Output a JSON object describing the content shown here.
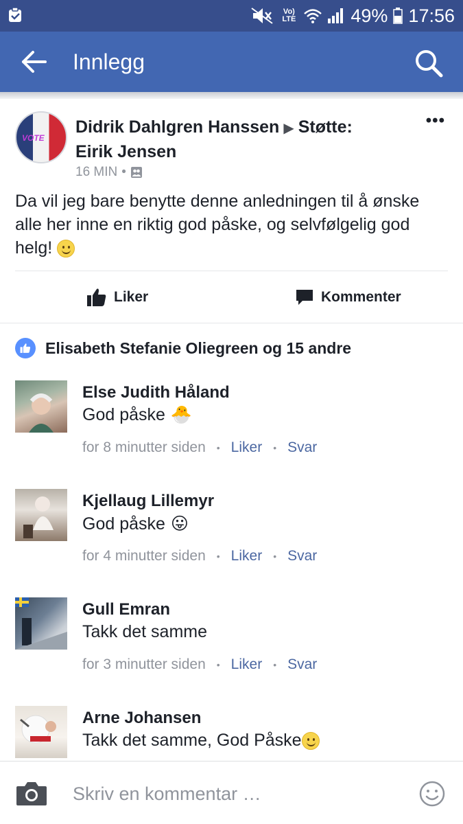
{
  "status_bar": {
    "volte_label": "Vo) LTE",
    "battery": "49%",
    "time": "17:56"
  },
  "app_bar": {
    "title": "Innlegg"
  },
  "post": {
    "author_line": "Didrik Dahlgren Hanssen",
    "target_line": "Støtte: Eirik Jensen",
    "time": "16 MIN",
    "separator": "•",
    "text": "Da vil jeg bare benytte denne anledningen til å ønske alle her inne en riktig god påske, og selvfølgelig god helg!",
    "more_label": "•••",
    "like_label": "Liker",
    "comment_label": "Kommenter"
  },
  "reactions": {
    "summary": "Elisabeth Stefanie Oliegreen og 15 andre"
  },
  "comments": [
    {
      "name": "Else Judith Håland",
      "text": "God påske",
      "emoji": "🐣",
      "time": "for 8 minutter siden",
      "like": "Liker",
      "reply": "Svar"
    },
    {
      "name": "Kjellaug Lillemyr",
      "text": "God påske",
      "emoji": "😛",
      "time": "for 4 minutter siden",
      "like": "Liker",
      "reply": "Svar"
    },
    {
      "name": "Gull Emran",
      "text": "Takk det samme",
      "emoji": "",
      "time": "for 3 minutter siden",
      "like": "Liker",
      "reply": "Svar"
    },
    {
      "name": "Arne Johansen",
      "text": "Takk det samme, God Påske",
      "emoji": "",
      "time": "",
      "like": "",
      "reply": ""
    }
  ],
  "composer": {
    "placeholder": "Skriv en kommentar …"
  },
  "colors": {
    "status_bar": "#374e8c",
    "app_bar": "#4267b2",
    "link": "#4b67a1",
    "meta": "#90949c",
    "like_blue": "#5890ff"
  },
  "icons": [
    "clipboard-check-icon",
    "mute-icon",
    "wifi-icon",
    "signal-icon",
    "battery-icon",
    "back-arrow-icon",
    "search-icon",
    "group-icon",
    "thumbs-up-icon",
    "comment-bubble-icon",
    "camera-icon",
    "smiley-icon"
  ]
}
